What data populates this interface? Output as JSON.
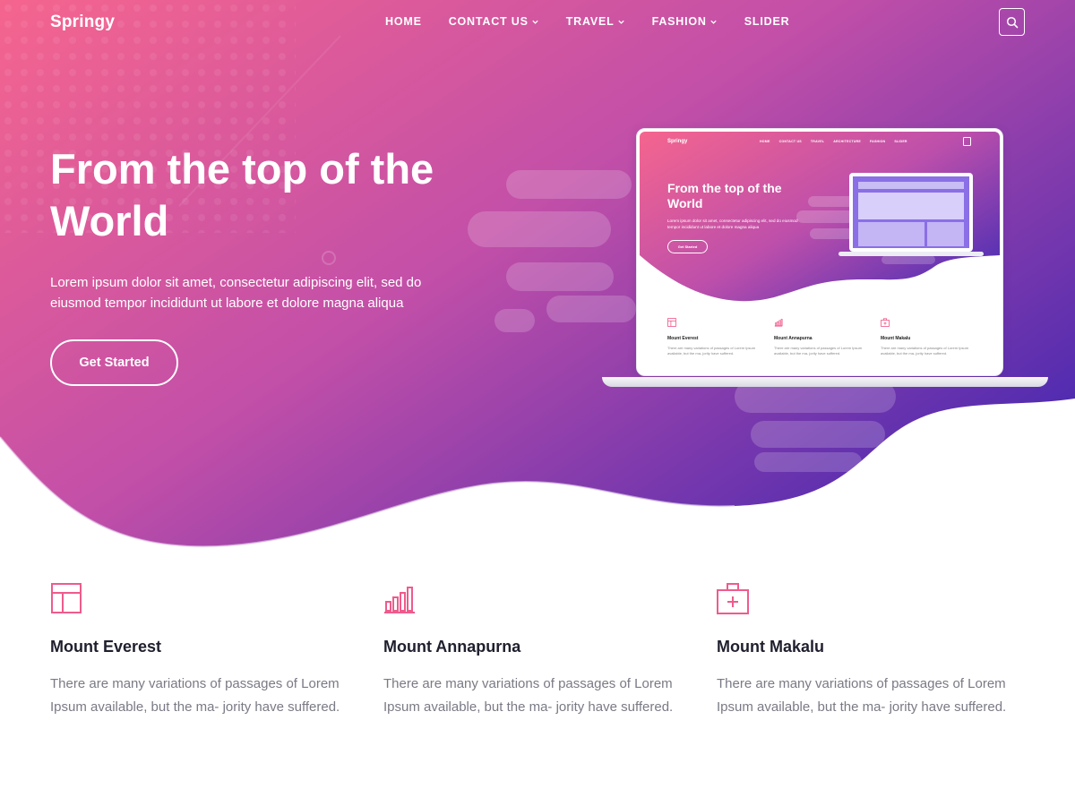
{
  "brand": "Springy",
  "nav": {
    "items": [
      {
        "label": "HOME",
        "dropdown": false
      },
      {
        "label": "CONTACT US",
        "dropdown": true
      },
      {
        "label": "TRAVEL",
        "dropdown": true
      },
      {
        "label": "FASHION",
        "dropdown": true
      },
      {
        "label": "SLIDER",
        "dropdown": false
      }
    ],
    "search_icon": "search-icon"
  },
  "hero": {
    "title": "From the top of the World",
    "subtitle": "Lorem ipsum dolor sit amet, consectetur adipiscing elit, sed do eiusmod tempor incididunt ut labore et dolore magna aliqua",
    "cta_label": "Get Started",
    "colors": {
      "gradient_start": "#f5658e",
      "gradient_mid": "#c24fa8",
      "gradient_end": "#5a2fb0"
    }
  },
  "mockup": {
    "brand": "Springy",
    "menu": [
      "HOME",
      "CONTACT US",
      "TRAVEL",
      "ARCHITECTURE",
      "FASHION",
      "SLIDER"
    ],
    "title": "From the top of the World",
    "subtitle": "Lorem ipsum dolor sit amet, consectetur adipiscing elit, sed do eiusmod tempor incididunt ut labore et dolore magna aliqua",
    "cta_label": "Get Started",
    "features": [
      {
        "title": "Mount Everest",
        "text": "There are many variations of passages of Lorem Ipsum available, but the ma- jority have suffered."
      },
      {
        "title": "Mount Annapurna",
        "text": "There are many variations of passages of Lorem Ipsum available, but the ma- jority have suffered."
      },
      {
        "title": "Mount Makalu",
        "text": "There are many variations of passages of Lorem Ipsum available, but the ma- jority have suffered."
      }
    ]
  },
  "features": [
    {
      "icon": "layout-icon",
      "title": "Mount Everest",
      "text": "There are many variations of passages of Lorem Ipsum available, but the ma- jority have suffered."
    },
    {
      "icon": "bar-chart-icon",
      "title": "Mount Annapurna",
      "text": "There are many variations of passages of Lorem Ipsum available, but the ma- jority have suffered."
    },
    {
      "icon": "medical-kit-icon",
      "title": "Mount Makalu",
      "text": "There are many variations of passages of Lorem Ipsum available, but the ma- jority have suffered."
    }
  ],
  "accent_color": "#ef5b8c"
}
